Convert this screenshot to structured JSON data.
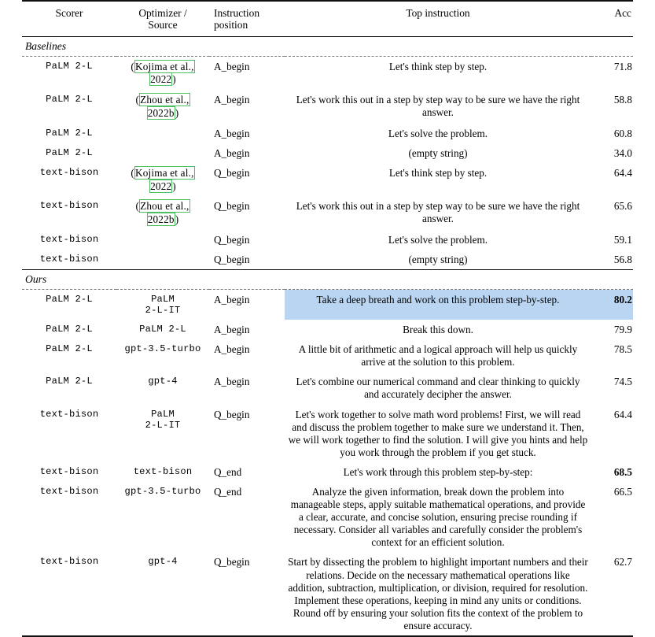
{
  "table": {
    "columns": [
      {
        "key": "scorer",
        "label": "Scorer"
      },
      {
        "key": "optimizer",
        "label": "Optimizer /\nSource"
      },
      {
        "key": "position",
        "label": "Instruction\nposition"
      },
      {
        "key": "instruction",
        "label": "Top instruction"
      },
      {
        "key": "acc",
        "label": "Acc"
      }
    ],
    "sections": [
      {
        "label": "Baselines",
        "rows": [
          {
            "scorer": "PaLM 2-L",
            "optimizer": "",
            "optimizer_citation": "Kojima et al.,\n2022",
            "position": "A_begin",
            "instruction": "Let's think step by step.",
            "acc": "71.8",
            "acc_bold": false,
            "highlight": false
          },
          {
            "scorer": "PaLM 2-L",
            "optimizer": "",
            "optimizer_citation": "Zhou et al.,\n2022b",
            "position": "A_begin",
            "instruction": "Let's work this out in a step by step way to be sure we have the right answer.",
            "acc": "58.8",
            "acc_bold": false,
            "highlight": false
          },
          {
            "scorer": "PaLM 2-L",
            "optimizer": "",
            "optimizer_citation": "",
            "position": "A_begin",
            "instruction": "Let's solve the problem.",
            "acc": "60.8",
            "acc_bold": false,
            "highlight": false
          },
          {
            "scorer": "PaLM 2-L",
            "optimizer": "",
            "optimizer_citation": "",
            "position": "A_begin",
            "instruction": "(empty string)",
            "acc": "34.0",
            "acc_bold": false,
            "highlight": false
          },
          {
            "scorer": "text-bison",
            "optimizer": "",
            "optimizer_citation": "Kojima et al.,\n2022",
            "position": "Q_begin",
            "instruction": "Let's think step by step.",
            "acc": "64.4",
            "acc_bold": false,
            "highlight": false
          },
          {
            "scorer": "text-bison",
            "optimizer": "",
            "optimizer_citation": "Zhou et al.,\n2022b",
            "position": "Q_begin",
            "instruction": "Let's work this out in a step by step way to be sure we have the right answer.",
            "acc": "65.6",
            "acc_bold": false,
            "highlight": false
          },
          {
            "scorer": "text-bison",
            "optimizer": "",
            "optimizer_citation": "",
            "position": "Q_begin",
            "instruction": "Let's solve the problem.",
            "acc": "59.1",
            "acc_bold": false,
            "highlight": false
          },
          {
            "scorer": "text-bison",
            "optimizer": "",
            "optimizer_citation": "",
            "position": "Q_begin",
            "instruction": "(empty string)",
            "acc": "56.8",
            "acc_bold": false,
            "highlight": false
          }
        ]
      },
      {
        "label": "Ours",
        "rows": [
          {
            "scorer": "PaLM 2-L",
            "optimizer": "PaLM\n2-L-IT",
            "optimizer_citation": "",
            "position": "A_begin",
            "instruction": "Take a deep breath and work on this problem step-by-step.",
            "acc": "80.2",
            "acc_bold": true,
            "highlight": true
          },
          {
            "scorer": "PaLM 2-L",
            "optimizer": "PaLM 2-L",
            "optimizer_citation": "",
            "position": "A_begin",
            "instruction": "Break this down.",
            "acc": "79.9",
            "acc_bold": false,
            "highlight": false
          },
          {
            "scorer": "PaLM 2-L",
            "optimizer": "gpt-3.5-turbo",
            "optimizer_citation": "",
            "position": "A_begin",
            "instruction": "A little bit of arithmetic and a logical approach will help us quickly arrive at the solution to this problem.",
            "acc": "78.5",
            "acc_bold": false,
            "highlight": false
          },
          {
            "scorer": "PaLM 2-L",
            "optimizer": "gpt-4",
            "optimizer_citation": "",
            "position": "A_begin",
            "instruction": "Let's combine our numerical command and clear thinking to quickly and accurately decipher the answer.",
            "acc": "74.5",
            "acc_bold": false,
            "highlight": false
          },
          {
            "scorer": "text-bison",
            "optimizer": "PaLM\n2-L-IT",
            "optimizer_citation": "",
            "position": "Q_begin",
            "instruction": "Let's work together to solve math word problems! First, we will read and discuss the problem together to make sure we understand it. Then, we will work together to find the solution. I will give you hints and help you work through the problem if you get stuck.",
            "acc": "64.4",
            "acc_bold": false,
            "highlight": false
          },
          {
            "scorer": "text-bison",
            "optimizer": "text-bison",
            "optimizer_citation": "",
            "position": "Q_end",
            "instruction": "Let's work through this problem step-by-step:",
            "acc": "68.5",
            "acc_bold": true,
            "highlight": false
          },
          {
            "scorer": "text-bison",
            "optimizer": "gpt-3.5-turbo",
            "optimizer_citation": "",
            "position": "Q_end",
            "instruction": "Analyze the given information, break down the problem into manageable steps, apply suitable mathematical operations, and provide a clear, accurate, and concise solution, ensuring precise rounding if necessary. Consider all variables and carefully consider the problem's context for an efficient solution.",
            "acc": "66.5",
            "acc_bold": false,
            "highlight": false
          },
          {
            "scorer": "text-bison",
            "optimizer": "gpt-4",
            "optimizer_citation": "",
            "position": "Q_begin",
            "instruction": "Start by dissecting the problem to highlight important numbers and their relations. Decide on the necessary mathematical operations like addition, subtraction, multiplication, or division, required for resolution. Implement these operations, keeping in mind any units or conditions. Round off by ensuring your solution fits the context of the problem to ensure accuracy.",
            "acc": "62.7",
            "acc_bold": false,
            "highlight": false
          }
        ]
      }
    ]
  },
  "colors": {
    "highlight": "#b9d5f2",
    "citation_box_border": "#4bbf62",
    "rule": "#111111",
    "dashed_rule": "#777777"
  }
}
